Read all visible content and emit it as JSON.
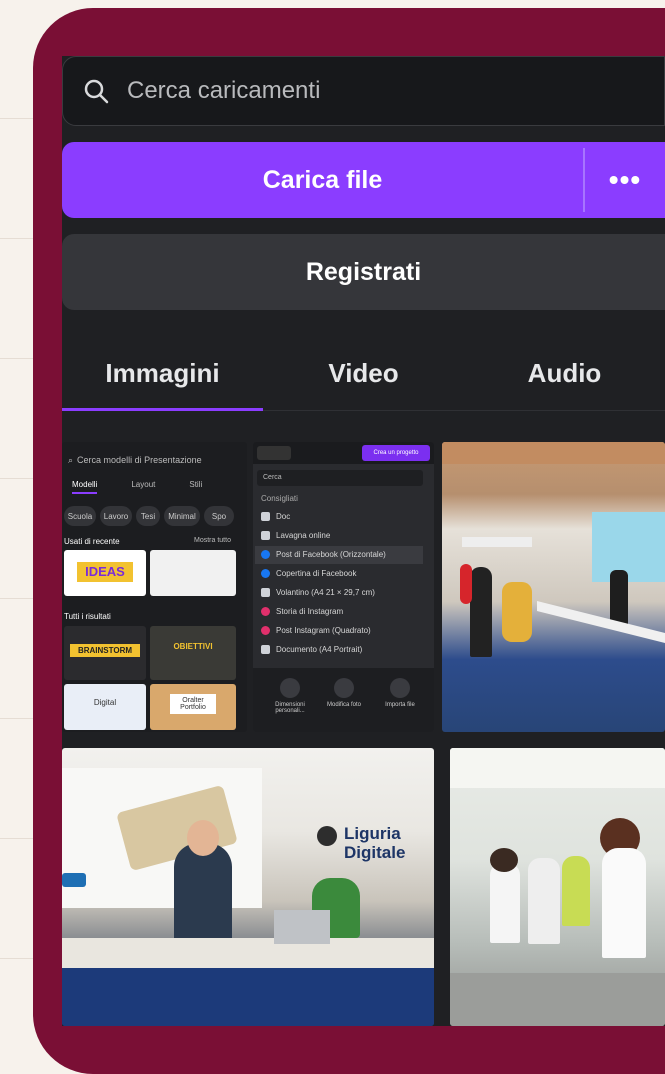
{
  "search": {
    "placeholder": "Cerca caricamenti"
  },
  "upload": {
    "label": "Carica file",
    "more_label": "•••"
  },
  "record": {
    "label": "Registrati"
  },
  "tabs": [
    {
      "label": "Immagini",
      "active": true
    },
    {
      "label": "Video",
      "active": false
    },
    {
      "label": "Audio",
      "active": false
    }
  ],
  "thumb1": {
    "search": "Cerca modelli di Presentazione",
    "tabs": [
      "Modelli",
      "Layout",
      "Stili"
    ],
    "chips": [
      "Scuola",
      "Lavoro",
      "Tesi",
      "Minimal",
      "Spo"
    ],
    "recent_label": "Usati di recente",
    "see_all": "Mostra tutto",
    "results_label": "Tutti i risultati",
    "card_texts": [
      "IDEAS",
      "BRAINSTORM",
      "OBIETTIVI",
      "Digital",
      "Oralter Portfolio"
    ]
  },
  "thumb2": {
    "create_button": "Crea un progetto",
    "search": "Cerca",
    "section": "Consigliati",
    "items": [
      "Doc",
      "Lavagna online",
      "Post di Facebook (Orizzontale)",
      "Copertina di Facebook",
      "Volantino (A4 21 × 29,7 cm)",
      "Storia di Instagram",
      "Post Instagram (Quadrato)",
      "Documento (A4 Portrait)"
    ],
    "footer": [
      "Dimensioni personali...",
      "Modifica foto",
      "Importa file"
    ]
  },
  "photo_logo": "Liguria Digitale",
  "colors": {
    "accent": "#8b3dff",
    "frame": "#7a0f35",
    "panel": "#1f2023"
  }
}
